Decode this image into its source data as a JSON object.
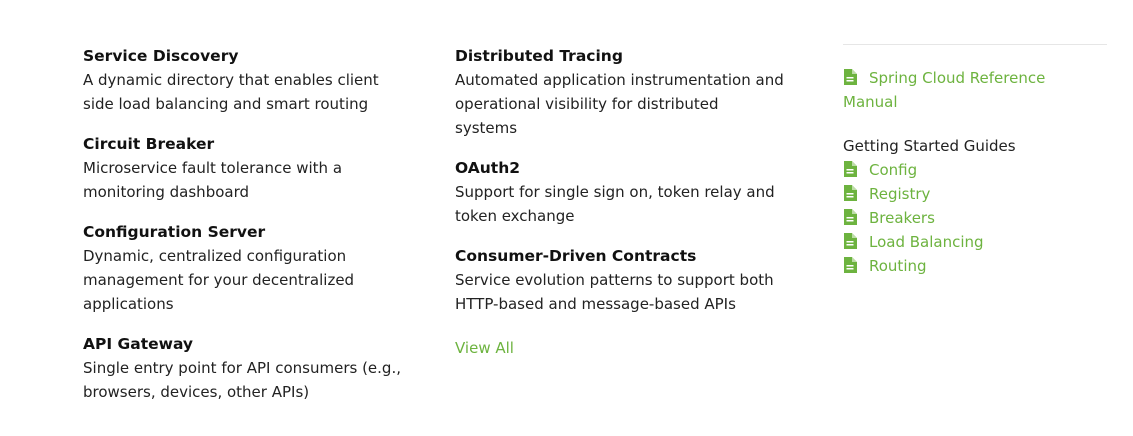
{
  "features_left": [
    {
      "title": "Service Discovery",
      "desc": "A dynamic directory that enables client side load balancing and smart routing"
    },
    {
      "title": "Circuit Breaker",
      "desc": "Microservice fault tolerance with a monitoring dashboard"
    },
    {
      "title": "Configuration Server",
      "desc": "Dynamic, centralized configuration management for your decentralized applications"
    },
    {
      "title": "API Gateway",
      "desc": "Single entry point for API consumers (e.g., browsers, devices, other APIs)"
    }
  ],
  "features_right": [
    {
      "title": "Distributed Tracing",
      "desc": "Automated application instrumentation and operational visibility for distributed systems"
    },
    {
      "title": "OAuth2",
      "desc": "Support for single sign on, token relay and token exchange"
    },
    {
      "title": "Consumer-Driven Contracts",
      "desc": "Service evolution patterns to support both HTTP-based and message-based APIs"
    }
  ],
  "view_all_label": "View All",
  "sidebar": {
    "reference_link": "Spring Cloud Reference Manual",
    "guides_heading": "Getting Started Guides",
    "guides": [
      "Config",
      "Registry",
      "Breakers",
      "Load Balancing",
      "Routing"
    ]
  },
  "icons": {
    "doc": "document-icon"
  },
  "colors": {
    "link": "#6db33f",
    "text": "#222222"
  }
}
